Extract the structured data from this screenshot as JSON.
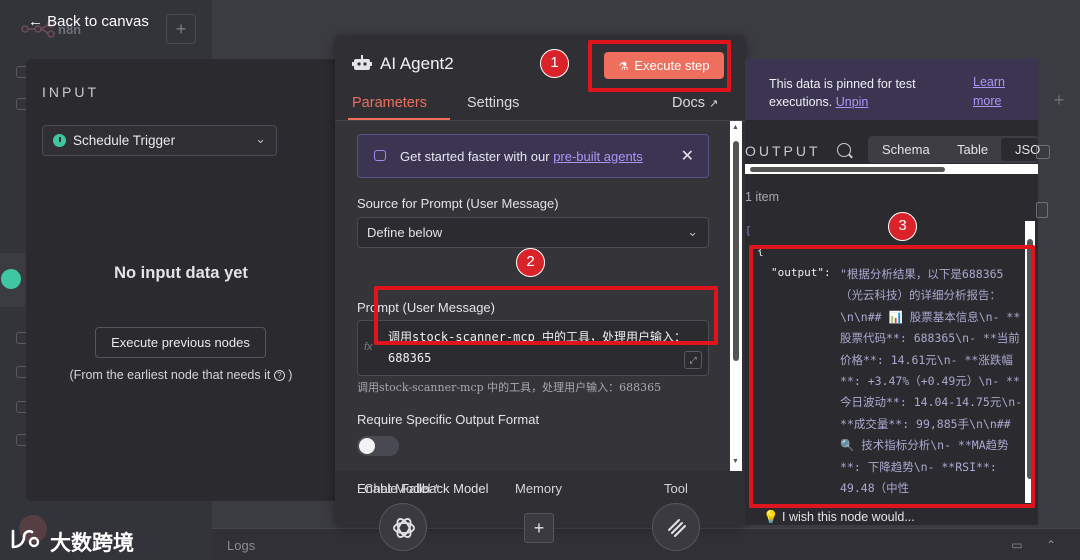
{
  "topbar": {
    "back_label": "Back to canvas",
    "app_name": "n8n"
  },
  "input_panel": {
    "title": "INPUT",
    "trigger_select": "Schedule Trigger",
    "empty_title": "No input data yet",
    "execute_previous_label": "Execute previous nodes",
    "note": "(From the earliest node that needs it",
    "note_end": ")"
  },
  "agent_panel": {
    "title": "AI Agent2",
    "execute_label": "Execute step",
    "tabs": [
      "Parameters",
      "Settings"
    ],
    "docs_label": "Docs",
    "banner_text": "Get started faster with our ",
    "banner_link": "pre-built agents",
    "source_label": "Source for Prompt (User Message)",
    "source_value": "Define below",
    "prompt_label": "Prompt (User Message)",
    "prompt_value": "调用stock-scanner-mcp 中的工具，处理用户输入：688365",
    "prompt_preview": "调用stock-scanner-mcp  中的工具，处理用户输入：688365",
    "require_format_label": "Require Specific Output Format",
    "fallback_label": "Enable Fallback Model",
    "footer": {
      "chat_model": "Chat Model *",
      "memory": "Memory",
      "tool": "Tool"
    }
  },
  "output_panel": {
    "pin_text": "This data is pinned for test executions.",
    "unpin_label": "Unpin",
    "learn_more": "Learn more",
    "title": "OUTPUT",
    "view_tabs": [
      "Schema",
      "Table",
      "JSO"
    ],
    "item_count": "1 item",
    "json_key": "\"output\":",
    "json_value": "\"根据分析结果，以下是688365（光云科技）的详细分析报告：\\n\\n## 📊 股票基本信息\\n- **股票代码**: 688365\\n- **当前价格**: 14.61元\\n- **涨跌幅**: +3.47%（+0.49元）\\n- **今日波动**: 14.04-14.75元\\n- **成交量**: 99,885手\\n\\n## 🔍 技术指标分析\\n- **MA趋势**: 下降趋势\\n- **RSI**: 49.48（中性",
    "feedback": "I wish this node would..."
  },
  "logs_label": "Logs",
  "annotations": [
    "1",
    "2",
    "3"
  ],
  "watermark": "大数跨境",
  "colors": {
    "accent": "#ee6f5e",
    "annotation": "#e0141d",
    "banner": "#3b3551",
    "link": "#a997f7"
  }
}
